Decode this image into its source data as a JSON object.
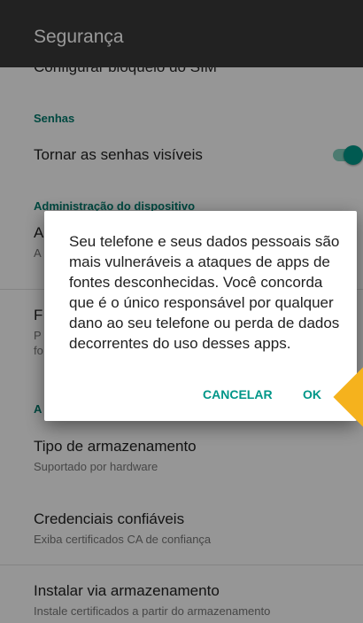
{
  "header": {
    "title": "Segurança"
  },
  "settings": {
    "sim_lock": {
      "title": "Configurar bloqueio do SIM"
    },
    "passwords_category": "Senhas",
    "visible_passwords": {
      "title": "Tornar as senhas visíveis",
      "toggle_on": true
    },
    "device_admin_category": "Administração do dispositivo",
    "device_admin_row": {
      "title": "A",
      "subtitle": "A"
    },
    "unknown_sources": {
      "title": "F",
      "subtitle_line1": "P",
      "subtitle_line2": "fo"
    },
    "storage_category": "A",
    "storage_type": {
      "title": "Tipo de armazenamento",
      "subtitle": "Suportado por hardware"
    },
    "trusted_credentials": {
      "title": "Credenciais confiáveis",
      "subtitle": "Exiba certificados CA de confiança"
    },
    "install_from_storage": {
      "title": "Instalar via armazenamento",
      "subtitle": "Instale certificados a partir do armazenamento"
    }
  },
  "dialog": {
    "message": "Seu telefone e seus dados pessoais são mais vulneráveis a ataques de apps de fontes desconhecidas. Você concorda que é o único responsável por qualquer dano ao seu telefone ou perda de dados decorrentes do uso desses apps.",
    "cancel_label": "CANCELAR",
    "ok_label": "OK"
  },
  "colors": {
    "accent": "#009688",
    "appbar": "#3a3a3a",
    "highlight": "#f5b21d"
  }
}
